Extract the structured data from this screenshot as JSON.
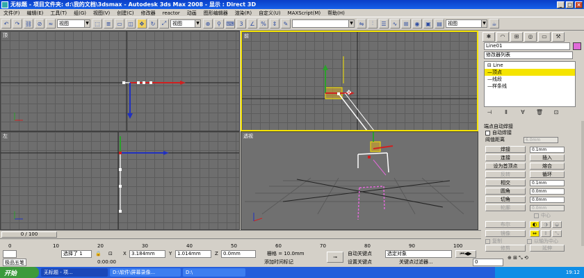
{
  "window": {
    "title": "无标题    - 项目文件夹: d:\\我的文档\\3dsmax    - Autodesk 3ds Max 2008    - 显示 : Direct 3D",
    "controls": [
      "_",
      "□",
      "×"
    ]
  },
  "menubar": {
    "items": [
      "文件(F)",
      "编辑(E)",
      "工具(T)",
      "组(G)",
      "视图(V)",
      "创建(C)",
      "修改器",
      "reactor",
      "动画",
      "图形编辑器",
      "渲染(R)",
      "自定义(U)",
      "MAXScript(M)",
      "帮助(H)"
    ]
  },
  "toolbar": {
    "selection_filter": "视图",
    "named_selection": "视图",
    "undo_icon": "undo-icon",
    "redo_icon": "redo-icon"
  },
  "viewports": {
    "top": {
      "label": "顶"
    },
    "front": {
      "label": "前"
    },
    "left": {
      "label": "左"
    },
    "persp": {
      "label": "透视"
    }
  },
  "command_panel": {
    "object_name": "Line01",
    "object_color": "#e06ad8",
    "modifier_list": "修改器列表",
    "stack": [
      {
        "label": "⊟ Line",
        "selected": false
      },
      {
        "label": "—顶点",
        "selected": true
      },
      {
        "label": "—线段",
        "selected": false
      },
      {
        "label": "—样条线",
        "selected": false
      }
    ],
    "rollout_title": "端点自动焊接",
    "auto_weld_label": "自动焊接",
    "weld_threshold_label": "阈值距离",
    "weld_threshold_value": "6.0mm",
    "buttons": {
      "weld": "焊接",
      "weld_value": "0.1mm",
      "connect": "连接",
      "insert": "插入",
      "make_first": "设为首顶点",
      "fuse": "熔合",
      "reverse": "反转",
      "cycle": "循环",
      "crossinsert": "相交",
      "crossinsert_value": "0.1mm",
      "fillet": "圆角",
      "fillet_value": "0.0mm",
      "chamfer": "切角",
      "chamfer_value": "0.0mm",
      "outline": "轮廓",
      "outline_value": "0.0mm",
      "center_label": "中心",
      "boolean": "布尔",
      "mirror": "镜像",
      "copy_label": "复制",
      "about_pivot_label": "以轴为中心",
      "trim": "修剪",
      "extend": "延伸"
    }
  },
  "timeline": {
    "frame": "0 / 100",
    "ticks": [
      "0",
      "10",
      "20",
      "30",
      "40",
      "50",
      "60",
      "70",
      "80",
      "90",
      "100"
    ]
  },
  "statusbar": {
    "selected": "选择了 1",
    "x_value": "3.184mm",
    "y_value": "1.014mm",
    "z_value": "0.0mm",
    "grid": "栅格 = 10.0mm",
    "auto_key": "自动关键点",
    "set_key": "设置关键点",
    "selected_object": "选定对象",
    "key_filters": "关键点过滤器...",
    "time_display": "0:00:00",
    "add_time_tag": "添加时间标记",
    "frame_value": "0",
    "maxscript_label": "极品五笔"
  },
  "taskbar": {
    "start": "开始",
    "tasks": [
      {
        "label": "无标题 - 项...",
        "active": true
      },
      {
        "label": "D:\\软件\\屏幕录像...",
        "active": false
      },
      {
        "label": "D:\\",
        "active": false
      }
    ],
    "clock": "19:12"
  }
}
